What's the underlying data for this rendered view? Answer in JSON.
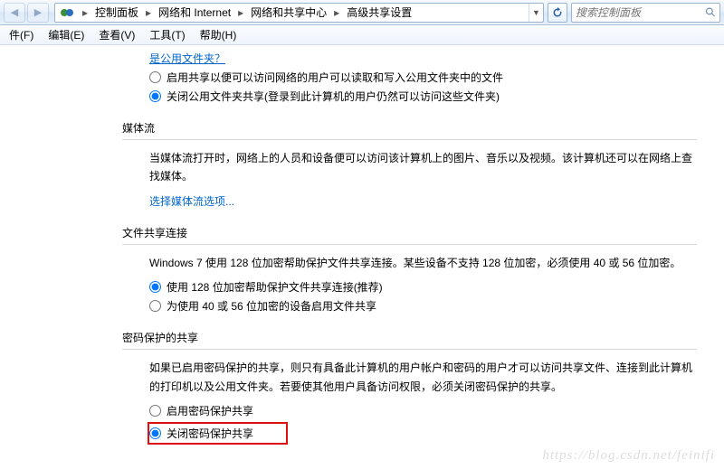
{
  "breadcrumb": {
    "segs": [
      "控制面板",
      "网络和 Internet",
      "网络和共享中心",
      "高级共享设置"
    ]
  },
  "search": {
    "placeholder": "搜索控制面板"
  },
  "menu": {
    "file": "件(F)",
    "edit": "编辑(E)",
    "view": "查看(V)",
    "tools": "工具(T)",
    "help": "帮助(H)"
  },
  "top_link": "是公用文件夹？",
  "public_folder": {
    "opt1": "启用共享以便可以访问网络的用户可以读取和写入公用文件夹中的文件",
    "opt2": "关闭公用文件夹共享(登录到此计算机的用户仍然可以访问这些文件夹)"
  },
  "media": {
    "title": "媒体流",
    "desc": "当媒体流打开时，网络上的人员和设备便可以访问该计算机上的图片、音乐以及视频。该计算机还可以在网络上查找媒体。",
    "link": "选择媒体流选项..."
  },
  "fileshare": {
    "title": "文件共享连接",
    "desc": "Windows 7 使用 128 位加密帮助保护文件共享连接。某些设备不支持 128 位加密，必须使用 40 或 56 位加密。",
    "opt1": "使用 128 位加密帮助保护文件共享连接(推荐)",
    "opt2": "为使用 40 或 56 位加密的设备启用文件共享"
  },
  "password": {
    "title": "密码保护的共享",
    "desc": "如果已启用密码保护的共享，则只有具备此计算机的用户帐户和密码的用户才可以访问共享文件、连接到此计算机的打印机以及公用文件夹。若要使其他用户具备访问权限，必须关闭密码保护的共享。",
    "opt1": "启用密码保护共享",
    "opt2": "关闭密码保护共享"
  },
  "watermark": "https://blog.csdn.net/feinifi"
}
